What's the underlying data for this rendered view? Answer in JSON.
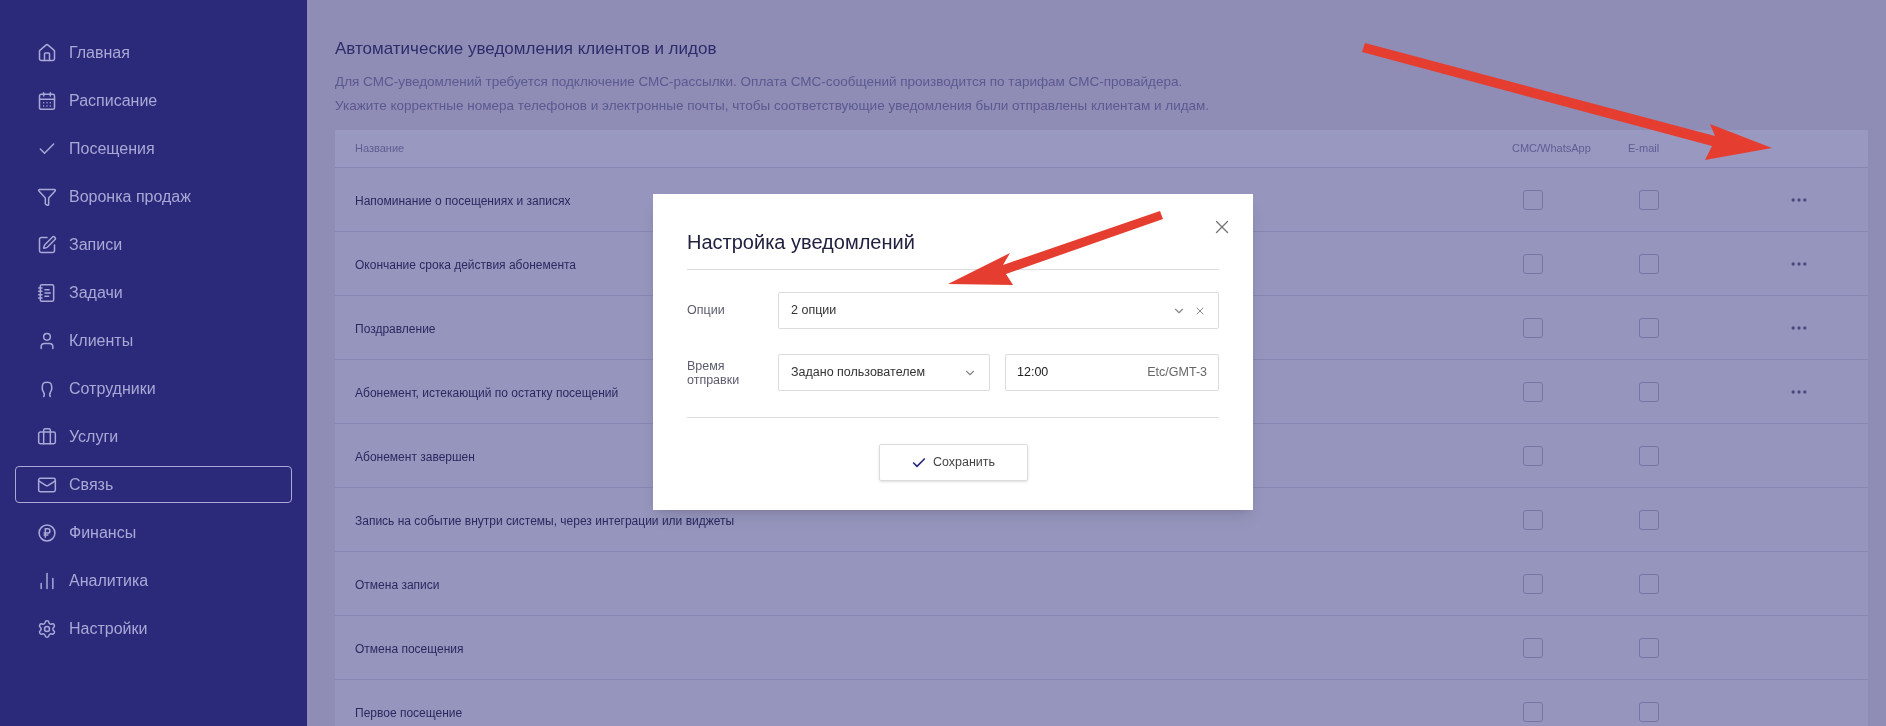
{
  "sidebar": {
    "items": [
      {
        "label": "Главная",
        "selected": false
      },
      {
        "label": "Расписание",
        "selected": false
      },
      {
        "label": "Посещения",
        "selected": false
      },
      {
        "label": "Воронка продаж",
        "selected": false
      },
      {
        "label": "Записи",
        "selected": false
      },
      {
        "label": "Задачи",
        "selected": false
      },
      {
        "label": "Клиенты",
        "selected": false
      },
      {
        "label": "Сотрудники",
        "selected": false
      },
      {
        "label": "Услуги",
        "selected": false
      },
      {
        "label": "Связь",
        "selected": true
      },
      {
        "label": "Финансы",
        "selected": false
      },
      {
        "label": "Аналитика",
        "selected": false
      },
      {
        "label": "Настройки",
        "selected": false
      }
    ]
  },
  "page": {
    "title": "Автоматические уведомления клиентов и лидов",
    "description": [
      "Для СМС-уведомлений требуется подключение СМС-рассылки. Оплата СМС-сообщений производится по тарифам СМС-провайдера.",
      "Укажите корректные номера телефонов и электронные почты, чтобы соответствующие уведомления были отправлены клиентам и лидам."
    ]
  },
  "table": {
    "columns": [
      "Название",
      "CMC/WhatsApp",
      "E-mail"
    ],
    "rows": [
      {
        "name": "Напоминание о посещениях и записях",
        "sms_checked": false,
        "email_checked": false,
        "menu": true
      },
      {
        "name": "Окончание срока действия абонемента",
        "sms_checked": false,
        "email_checked": false,
        "menu": true
      },
      {
        "name": "Поздравление",
        "sms_checked": false,
        "email_checked": false,
        "menu": true
      },
      {
        "name": "Абонемент, истекающий по остатку посещений",
        "sms_checked": false,
        "email_checked": false,
        "menu": true
      },
      {
        "name": "Абонемент завершен",
        "sms_checked": false,
        "email_checked": false,
        "menu": false
      },
      {
        "name": "Запись на событие внутри системы, через интеграции или виджеты",
        "sms_checked": false,
        "email_checked": false,
        "menu": false
      },
      {
        "name": "Отмена записи",
        "sms_checked": false,
        "email_checked": false,
        "menu": false
      },
      {
        "name": "Отмена посещения",
        "sms_checked": false,
        "email_checked": false,
        "menu": false
      },
      {
        "name": "Первое посещение",
        "sms_checked": false,
        "email_checked": false,
        "menu": false
      }
    ]
  },
  "modal": {
    "title": "Настройка уведомлений",
    "options_label": "Опции",
    "options_value": "2 опции",
    "time_label": "Время отправки",
    "time_mode": "Задано пользователем",
    "time_value": "12:00",
    "timezone": "Etc/GMT-3",
    "save_button": "Сохранить"
  }
}
